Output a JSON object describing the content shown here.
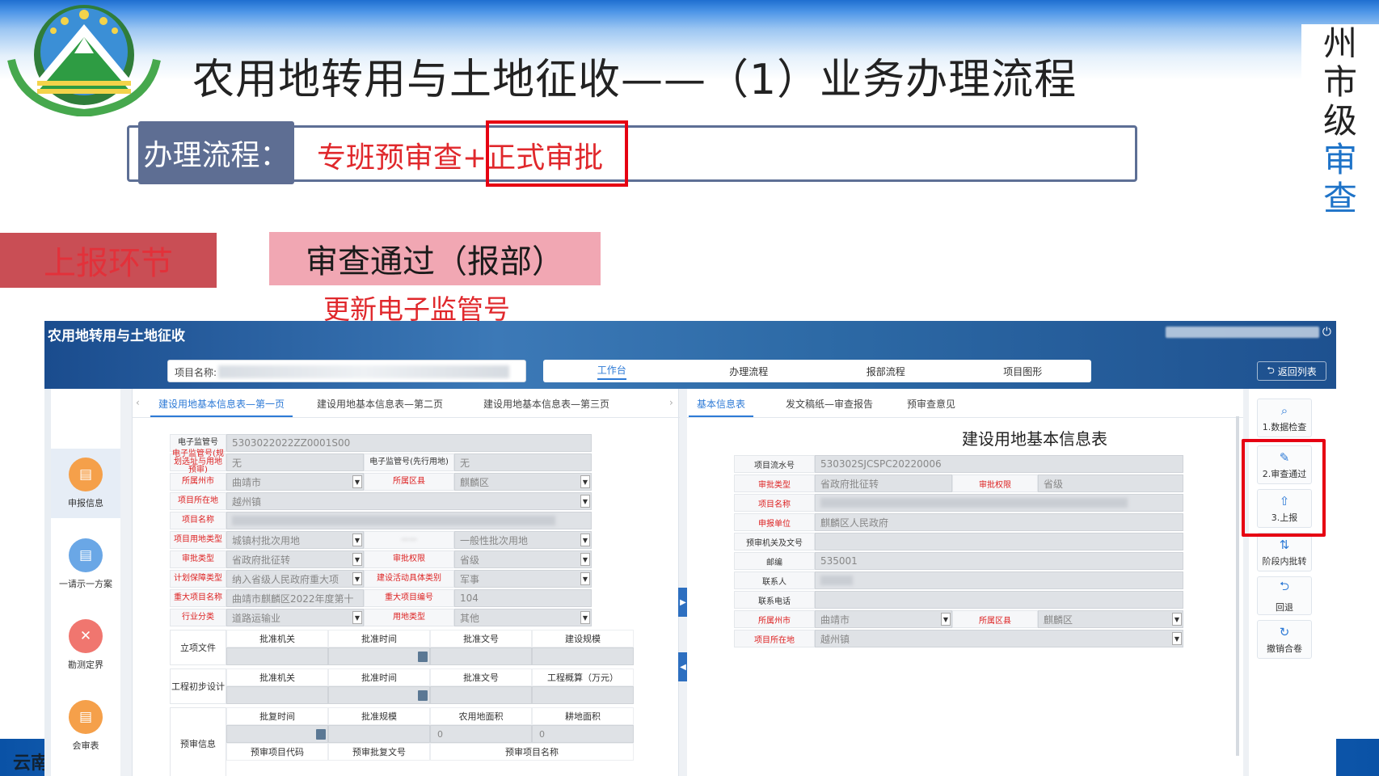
{
  "slide": {
    "title": "农用地转用与土地征收——（1）业务办理流程",
    "vertical_label": [
      "州",
      "市",
      "级",
      "审",
      "查"
    ],
    "flow_label": "办理流程：",
    "flow_text": "专班预审查+正式审批",
    "section_left": "上报环节",
    "section_right": "审查通过（报部）",
    "note": "更新电子监管号",
    "footer_text": "云南",
    "colors": {
      "accent_red": "#e60012",
      "flow_label_bg": "#5e6e93",
      "pink": "#f1a7b3",
      "blue": "#2d7ad6"
    }
  },
  "app": {
    "title": "农用地转用与土地征收",
    "project_label": "项目名称:",
    "nav_tabs": [
      "工作台",
      "办理流程",
      "报部流程",
      "项目图形"
    ],
    "back_button": "返回列表",
    "sidebar": [
      {
        "label": "申报信息",
        "icon": "document-icon",
        "color": "#f5a04a"
      },
      {
        "label": "一请示一方案",
        "icon": "document-icon",
        "color": "#6aa7e6"
      },
      {
        "label": "勘测定界",
        "icon": "tools-icon",
        "color": "#f0766f"
      },
      {
        "label": "会审表",
        "icon": "document-icon",
        "color": "#f5a04a"
      }
    ],
    "left_tabs": [
      "建设用地基本信息表—第一页",
      "建设用地基本信息表—第二页",
      "建设用地基本信息表—第三页"
    ],
    "left_form": {
      "electronic_no_label": "电子监管号",
      "electronic_no": "5303022022ZZ0001S00",
      "plan_no_label": "电子监管号(规划选址与用地预审)",
      "plan_no": "无",
      "first_no_label": "电子监管号(先行用地)",
      "first_no": "无",
      "city_label": "所属州市",
      "city": "曲靖市",
      "district_label": "所属区县",
      "district": "麒麟区",
      "location_label": "项目所在地",
      "location": "越州镇",
      "name_label": "项目名称",
      "use_type_label": "项目用地类型",
      "use_type": "城镇村批次用地",
      "use_subtype": "一般性批次用地",
      "approve_type_label": "审批类型",
      "approve_type": "省政府批征转",
      "authority_label": "审批权限",
      "authority": "省级",
      "plan_type_label": "计划保障类型",
      "plan_type": "纳入省级人民政府重大项",
      "activity_label": "建设活动具体类别",
      "activity": "军事",
      "major_name_label": "重大项目名称",
      "major_name": "曲靖市麒麟区2022年度第十",
      "major_no_label": "重大项目编号",
      "major_no": "104",
      "industry_label": "行业分类",
      "industry": "道路运输业",
      "land_type_label": "用地类型",
      "land_type": "其他",
      "group1_label": "立项文件",
      "group1_cols": [
        "批准机关",
        "批准时间",
        "批准文号",
        "建设规模"
      ],
      "group2_label": "工程初步设计",
      "group2_cols": [
        "批准机关",
        "批准时间",
        "批准文号",
        "工程概算（万元）"
      ],
      "group3_label": "预审信息",
      "group3_cols": [
        "批复时间",
        "批准规模",
        "农用地面积",
        "耕地面积"
      ],
      "group3_vals": [
        "",
        "",
        "0",
        "0"
      ],
      "group4_cols": [
        "预审项目代码",
        "预审批复文号",
        "预审项目名称"
      ]
    },
    "right_tabs": [
      "基本信息表",
      "发文稿纸—审查报告",
      "预审查意见"
    ],
    "right_title": "建设用地基本信息表",
    "right_form": {
      "serial_label": "项目流水号",
      "serial": "530302SJCSPC20220006",
      "approve_type_label": "审批类型",
      "approve_type": "省政府批征转",
      "authority_label": "审批权限",
      "authority": "省级",
      "name_label": "项目名称",
      "unit_label": "申报单位",
      "unit": "麒麟区人民政府",
      "pre_label": "预审机关及文号",
      "zip_label": "邮编",
      "zip": "535001",
      "contact_label": "联系人",
      "phone_label": "联系电话",
      "city_label": "所属州市",
      "city": "曲靖市",
      "district_label": "所属区县",
      "district": "麒麟区",
      "location_label": "项目所在地",
      "location": "越州镇"
    },
    "actions": [
      {
        "label": "1.数据检查",
        "icon": "search-icon"
      },
      {
        "label": "2.审查通过",
        "icon": "approve-icon"
      },
      {
        "label": "3.上报",
        "icon": "upload-icon"
      },
      {
        "label": "阶段内批转",
        "icon": "transfer-icon"
      },
      {
        "label": "回退",
        "icon": "return-icon"
      },
      {
        "label": "撤销合卷",
        "icon": "refresh-icon"
      }
    ]
  }
}
